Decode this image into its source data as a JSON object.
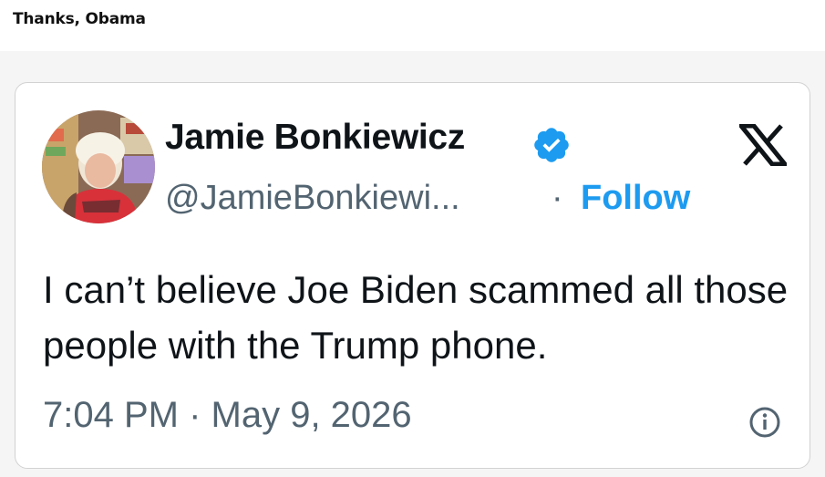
{
  "post": {
    "caption": "Thanks, Obama"
  },
  "tweet": {
    "author_name": "Jamie Bonkiewicz",
    "author_handle": "@JamieBonkiewi...",
    "follow_separator": "·",
    "follow_label": "Follow",
    "text": "I can’t believe Joe Biden scammed all those people with the Trump phone.",
    "timestamp": "7:04 PM · May 9, 2026",
    "icons": {
      "verified": "verified-badge-icon",
      "brand": "x-logo-icon",
      "info": "info-icon"
    },
    "colors": {
      "follow": "#1d9bf0",
      "verified": "#1d9bf0",
      "secondary_text": "#536471",
      "primary_text": "#0f1419"
    }
  }
}
